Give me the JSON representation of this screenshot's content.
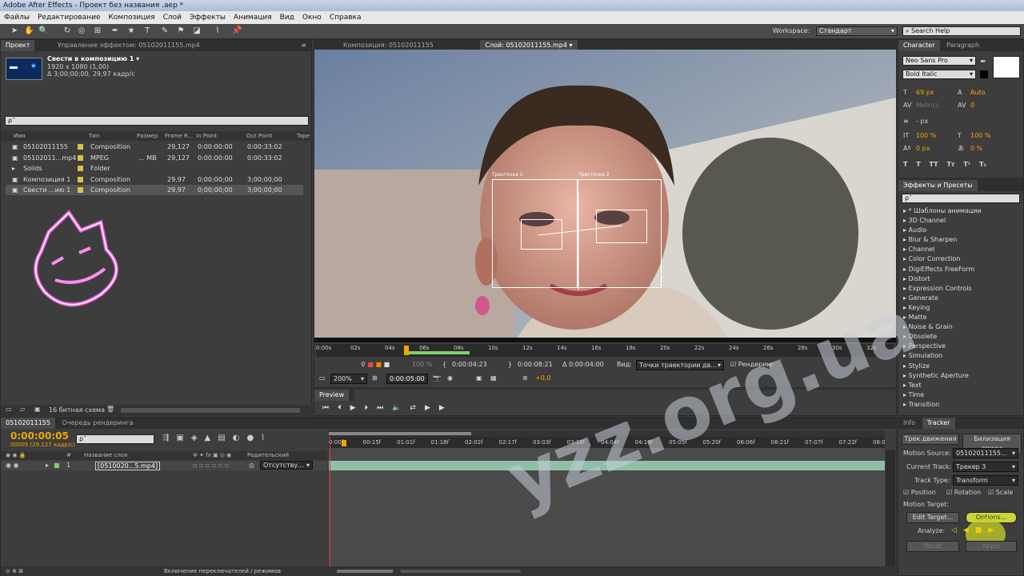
{
  "window": {
    "title": "Adobe After Effects - Проект без названия .aep *"
  },
  "menu": [
    "Файлы",
    "Редактирование",
    "Композиция",
    "Слой",
    "Эффекты",
    "Анимация",
    "Вид",
    "Окно",
    "Справка"
  ],
  "workspace": {
    "label": "Workspace:",
    "value": "Стандарт",
    "search_placeholder": "Search Help"
  },
  "project": {
    "tabs": [
      "Проект",
      "Управление эффектом: 05102011155.mp4"
    ],
    "thumb_title": "Свести в композицию 1 ▾",
    "thumb_line2": "1920 x 1080 (1,00)",
    "thumb_line3": "Δ 3;00;00;00, 29,97 кадр/с",
    "search_value": "ρ˜",
    "columns": [
      "Имя",
      "Тип",
      "Размер",
      "Frame R...",
      "In Point",
      "Out Point",
      "Tape"
    ],
    "items": [
      {
        "name": "05102011155",
        "type": "Composition",
        "size": "",
        "fps": "29,127",
        "in": "0:00:00:00",
        "out": "0:00:33:02"
      },
      {
        "name": "05102011...mp4",
        "type": "MPEG",
        "size": "... MB",
        "fps": "29,127",
        "in": "0:00:00:00",
        "out": "0:00:33:02"
      },
      {
        "name": "Solids",
        "type": "Folder",
        "size": "",
        "fps": "",
        "in": "",
        "out": ""
      },
      {
        "name": "Композиция 1",
        "type": "Composition",
        "size": "",
        "fps": "29,97",
        "in": "0;00;00;00",
        "out": "3;00;00;00"
      },
      {
        "name": "Свести ...ию 1",
        "type": "Composition",
        "size": "",
        "fps": "29,97",
        "in": "0;00;00;00",
        "out": "3;00;00;00"
      }
    ],
    "bit_depth": "16 битная схема"
  },
  "viewer": {
    "tabs": [
      "Композиция: 05102011155",
      "Слой: 05102011155.mp4 ▾"
    ],
    "track_labels": [
      "Тректочка 1",
      "Тректочка 2"
    ],
    "ruler": [
      "0:00s",
      "02s",
      "04s",
      "06s",
      "08s",
      "10s",
      "12s",
      "14s",
      "16s",
      "18s",
      "20s",
      "22s",
      "24s",
      "26s",
      "28s",
      "30s",
      "32s"
    ],
    "time_current": "0:00:04:23",
    "time_end": "0:00:08:21",
    "time_delta": "Δ 0:00:04:00",
    "view_label": "Вид:",
    "view_value": "Точки траектории дв...",
    "render_label": "Рендеринг",
    "zoom": "200%",
    "timecode": "0:00:05:00",
    "exposure": "+0,0",
    "opacity": "100 %"
  },
  "preview": {
    "tab": "Preview"
  },
  "character": {
    "tabs": [
      "Character",
      "Paragraph"
    ],
    "font": "Neo Sans Pro",
    "style": "Bold Italic",
    "size": "69 px",
    "leading": "Auto",
    "kerning": "Metrics",
    "tracking": "0",
    "stroke": "- px",
    "vscale": "100 %",
    "hscale": "100 %",
    "baseline": "0 px",
    "tsume": "0 %",
    "styles": [
      "T",
      "T",
      "TT",
      "Tт",
      "T¹",
      "T₁"
    ]
  },
  "effects": {
    "title": "Эффекты и Пресеты",
    "search_value": "ρ˜",
    "items": [
      "* Шаблоны анимации",
      "3D Channel",
      "Audio",
      "Blur & Sharpen",
      "Channel",
      "Color Correction",
      "DigiEffects FreeForm",
      "Distort",
      "Expression Controls",
      "Generate",
      "Keying",
      "Matte",
      "Noise & Grain",
      "Obsolete",
      "Perspective",
      "Simulation",
      "Stylize",
      "Synthetic Aperture",
      "Text",
      "Time",
      "Transition"
    ]
  },
  "timeline": {
    "tabs": [
      "05102011155",
      "Очередь рендеринга"
    ],
    "timecode": "0:00:00:05",
    "fps_sub": "00005 (29,127 кадр/с)",
    "search_value": "ρ˜",
    "col_headers": [
      "#",
      "Название слоя",
      "Родительский"
    ],
    "layer": {
      "num": "1",
      "name": "[0510020...5.mp4]",
      "parent": "Отсутству..."
    },
    "ruler": [
      "0:00f",
      "00:15f",
      "01:01f",
      "01:16f",
      "02:02f",
      "02:17f",
      "03:03f",
      "03:18f",
      "04:04f",
      "04:19f",
      "05:05f",
      "05:20f",
      "06:06f",
      "06:21f",
      "07:07f",
      "07:22f",
      "08:0"
    ],
    "switch_label": "Включение переключателей / режимов"
  },
  "tracker": {
    "tabs": [
      "Info",
      "Tracker"
    ],
    "btn_track": "Трек движения",
    "btn_stabilize": "Билизация движе",
    "motion_source_label": "Motion Source:",
    "motion_source": "05102011155...",
    "current_track_label": "Current Track:",
    "current_track": "Трекер 3",
    "track_type_label": "Track Type:",
    "track_type": "Transform",
    "position": "Position",
    "rotation": "Rotation",
    "scale": "Scale",
    "motion_target_label": "Motion Target:",
    "edit_target": "Edit Target...",
    "options": "Options...",
    "analyze_label": "Analyze:",
    "reset": "Reset",
    "apply": "Apply"
  },
  "watermark": "yzz.org.ua",
  "colors": {
    "accent": "#f0a800",
    "panel": "#3d3d3d",
    "dark": "#2f2f2f",
    "tracker_green": "#a8d060"
  }
}
